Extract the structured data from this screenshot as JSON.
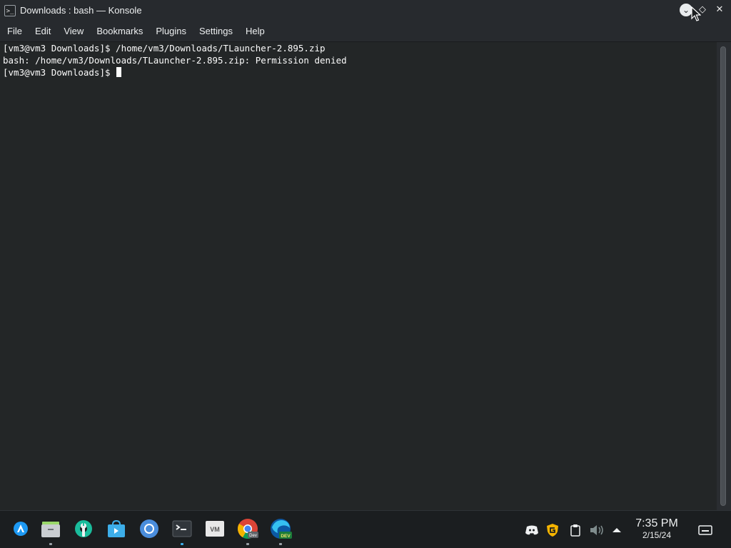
{
  "window": {
    "title": "Downloads : bash — Konsole",
    "app_icon": "konsole-icon",
    "controls": [
      "minimize-icon",
      "maximize-icon",
      "close-icon"
    ]
  },
  "menubar": {
    "items": [
      "File",
      "Edit",
      "View",
      "Bookmarks",
      "Plugins",
      "Settings",
      "Help"
    ]
  },
  "terminal": {
    "lines": [
      "[vm3@vm3 Downloads]$ /home/vm3/Downloads/TLauncher-2.895.zip",
      "bash: /home/vm3/Downloads/TLauncher-2.895.zip: Permission denied",
      "[vm3@vm3 Downloads]$ "
    ],
    "background": "#232627",
    "foreground": "#fcfcfc"
  },
  "taskbar": {
    "launcher_icon": "application-launcher-icon",
    "apps": [
      {
        "icon": "file-manager-icon",
        "running": true
      },
      {
        "icon": "system-settings-icon",
        "running": false
      },
      {
        "icon": "discover-store-icon",
        "running": false
      },
      {
        "icon": "chromium-icon",
        "running": false
      },
      {
        "icon": "konsole-icon",
        "running": true
      },
      {
        "icon": "vmware-icon",
        "running": false
      },
      {
        "icon": "chrome-dev-icon",
        "running": true
      },
      {
        "icon": "edge-dev-icon",
        "running": true
      }
    ],
    "tray": [
      "discord-icon",
      "guard-icon",
      "clipboard-icon",
      "volume-muted-icon",
      "tray-expand-icon"
    ],
    "clock": {
      "time": "7:35 PM",
      "date": "2/15/24"
    },
    "show_desktop_icon": "show-desktop-icon",
    "accent": "#3daee9"
  }
}
